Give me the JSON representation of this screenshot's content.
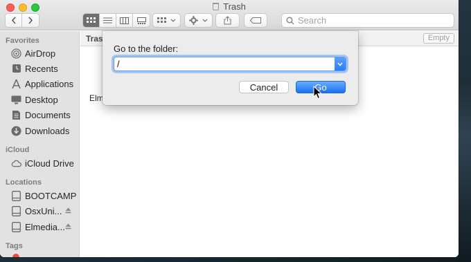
{
  "window": {
    "title": "Trash"
  },
  "toolbar": {
    "search_placeholder": "Search"
  },
  "sidebar": {
    "sections": [
      {
        "heading": "Favorites",
        "items": [
          {
            "label": "AirDrop",
            "icon": "airdrop-icon"
          },
          {
            "label": "Recents",
            "icon": "clock-icon"
          },
          {
            "label": "Applications",
            "icon": "applications-icon"
          },
          {
            "label": "Desktop",
            "icon": "desktop-icon"
          },
          {
            "label": "Documents",
            "icon": "document-icon"
          },
          {
            "label": "Downloads",
            "icon": "download-icon"
          }
        ]
      },
      {
        "heading": "iCloud",
        "items": [
          {
            "label": "iCloud Drive",
            "icon": "cloud-icon"
          }
        ]
      },
      {
        "heading": "Locations",
        "items": [
          {
            "label": "BOOTCAMP",
            "icon": "drive-icon"
          },
          {
            "label": "OsxUni...",
            "icon": "drive-icon",
            "ejectable": true
          },
          {
            "label": "Elmedia...",
            "icon": "drive-icon",
            "ejectable": true
          }
        ]
      },
      {
        "heading": "Tags",
        "items": []
      }
    ]
  },
  "content": {
    "path_label": "Trash",
    "empty_button": "Empty",
    "file_partial": "Elm"
  },
  "dialog": {
    "title": "Go to the folder:",
    "path_value": "/",
    "cancel_label": "Cancel",
    "go_label": "Go"
  },
  "colors": {
    "accent": "#2a7ef2",
    "sidebar_bg": "#e2e2e3",
    "close": "#fe5f57",
    "minimize": "#febc2e",
    "maximize": "#28c840"
  }
}
